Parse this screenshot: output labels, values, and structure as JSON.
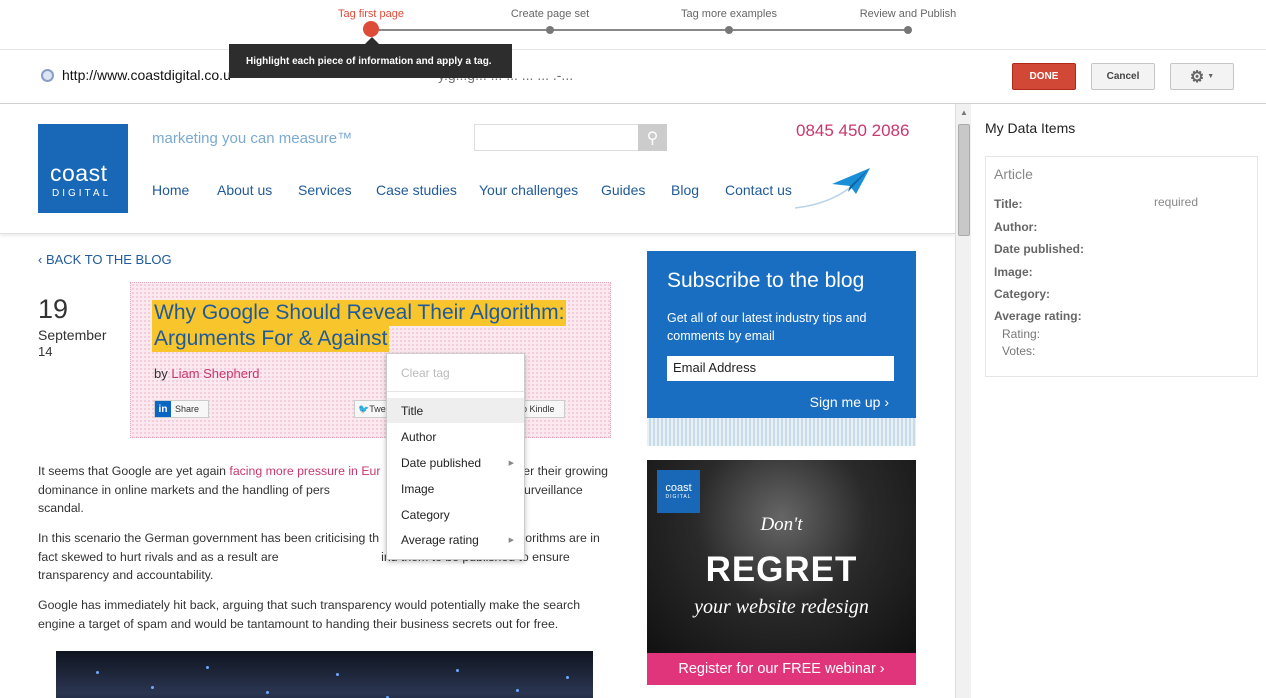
{
  "wizard": {
    "steps": [
      {
        "label": "Tag first page",
        "active": true
      },
      {
        "label": "Create page set",
        "active": false
      },
      {
        "label": "Tag more examples",
        "active": false
      },
      {
        "label": "Review and Publish",
        "active": false
      }
    ],
    "tooltip": "Highlight each piece of information and apply a tag."
  },
  "urlbar": {
    "url": "http://www.coastdigital.co.u",
    "url_tail": "y.g...g... ... ... ... ... .-...",
    "done_label": "DONE",
    "cancel_label": "Cancel"
  },
  "site": {
    "logo_line1": "coast",
    "logo_line2": "DIGITAL",
    "tagline": "marketing you can measure™",
    "phone": "0845 450 2086",
    "nav": [
      "Home",
      "About us",
      "Services",
      "Case studies",
      "Your challenges",
      "Guides",
      "Blog",
      "Contact us"
    ],
    "back_link": "‹ BACK TO THE BLOG",
    "date_day": "19",
    "date_month": "September",
    "date_year": "14",
    "title_line1": "Why Google Should Reveal Their Algorithm:",
    "title_line2": "Arguments For & Against",
    "by_prefix": "by ",
    "author": "Liam Shepherd",
    "share_linkedin": "Share",
    "share_twitter": "Twe",
    "share_kindle": "o Kindle",
    "para1_pre": "It seems that Google are yet again ",
    "para1_link": "facing more pressure in Eur",
    "para1_post": "                              erns over their growing dominance in online markets and the handling of pers                              the US internet surveillance scandal.",
    "para2": "In this scenario the German government has been criticising th                              their algorithms are in fact skewed to hurt rivals and as a result are                              ind them to be published to ensure transparency and accountability.",
    "para3": "Google has immediately hit back, arguing that such transparency would potentially make the search engine a target of spam and would be tantamount to handing their business secrets out for free.",
    "subscribe_title": "Subscribe to the blog",
    "subscribe_desc": "Get all of our latest industry tips and comments by email",
    "email_placeholder": "Email Address",
    "signup": "Sign me up ›",
    "ad_logo1": "coast",
    "ad_logo2": "DIGITAL",
    "ad_dont": "Don't",
    "ad_regret": "REGRET",
    "ad_redesign": "your website redesign",
    "ad_cta": "Register for our FREE webinar ›"
  },
  "menu": {
    "items": [
      {
        "label": "Clear tag",
        "disabled": true
      },
      {
        "label": "Title",
        "highlighted": true
      },
      {
        "label": "Author"
      },
      {
        "label": "Date published",
        "submenu": true
      },
      {
        "label": "Image"
      },
      {
        "label": "Category"
      },
      {
        "label": "Average rating",
        "submenu": true
      }
    ]
  },
  "panel": {
    "title": "My Data Items",
    "card_title": "Article",
    "fields": [
      "Title:",
      "Author:",
      "Date published:",
      "Image:",
      "Category:",
      "Average rating:"
    ],
    "required": "required",
    "subfields": [
      "Rating:",
      "Votes:"
    ]
  },
  "colors": {
    "accent": "#dd4b39",
    "brand_blue": "#1868b7",
    "highlight": "#f8c52c",
    "pink": "#c9376e"
  }
}
